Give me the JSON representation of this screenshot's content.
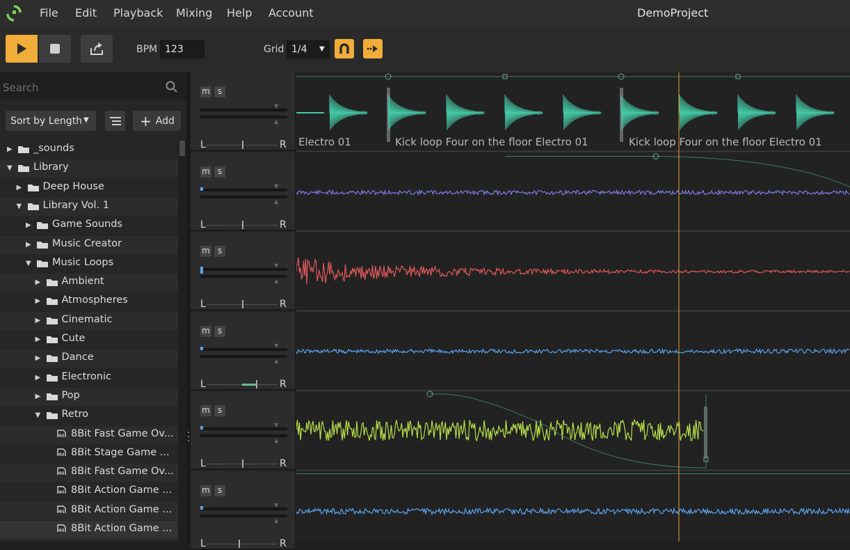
{
  "menu": {
    "file": "File",
    "edit": "Edit",
    "playback": "Playback",
    "mixing": "Mixing",
    "help": "Help",
    "account": "Account"
  },
  "project_title": "DemoProject",
  "toolbar": {
    "bpm_label": "BPM",
    "bpm_value": "123",
    "grid_label": "Grid",
    "grid_value": "1/4"
  },
  "sidebar": {
    "search_placeholder": "Search",
    "sort_label": "Sort by Length",
    "add_label": "Add",
    "tree": [
      {
        "label": "_sounds",
        "state": "collapsed"
      },
      {
        "label": "Library",
        "state": "expanded"
      },
      {
        "label": "Deep House",
        "state": "collapsed"
      },
      {
        "label": "Library Vol. 1",
        "state": "expanded"
      },
      {
        "label": "Game Sounds",
        "state": "collapsed"
      },
      {
        "label": "Music Creator",
        "state": "collapsed"
      },
      {
        "label": "Music Loops",
        "state": "expanded"
      },
      {
        "label": "Ambient",
        "state": "collapsed"
      },
      {
        "label": "Atmospheres",
        "state": "collapsed"
      },
      {
        "label": "Cinematic",
        "state": "collapsed"
      },
      {
        "label": "Cute",
        "state": "collapsed"
      },
      {
        "label": "Dance",
        "state": "collapsed"
      },
      {
        "label": "Electronic",
        "state": "collapsed"
      },
      {
        "label": "Pop",
        "state": "collapsed"
      },
      {
        "label": "Retro",
        "state": "expanded"
      },
      {
        "label": "8Bit Fast Game Ov...",
        "state": "file"
      },
      {
        "label": "8Bit Stage Game ...",
        "state": "file"
      },
      {
        "label": "8Bit Fast Game Ov...",
        "state": "file"
      },
      {
        "label": "8Bit Action Game ...",
        "state": "file"
      },
      {
        "label": "8Bit Action Game ...",
        "state": "file"
      },
      {
        "label": "8Bit Action Game ...",
        "state": "file"
      }
    ]
  },
  "tracks": {
    "mute_label": "m",
    "solo_label": "s",
    "pan_left": "L",
    "pan_right": "R",
    "clip_labels": [
      "Electro 01",
      "Kick loop Four on the floor Electro 01",
      "Kick loop Four on the floor Electro 01"
    ],
    "colors": [
      "#45c9a6",
      "#7b7ce6",
      "#e0585a",
      "#5aa4ee",
      "#b8e04a",
      "#5aa4ee"
    ]
  },
  "colors": {
    "accent": "#f0ad3a",
    "playhead": "#e0a43a"
  }
}
